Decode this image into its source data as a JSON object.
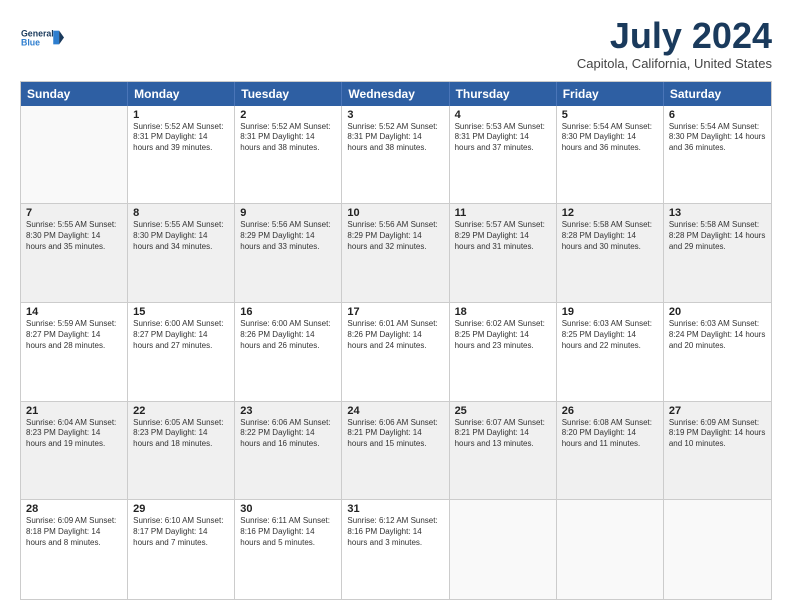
{
  "header": {
    "logo_line1": "General",
    "logo_line2": "Blue",
    "month": "July 2024",
    "location": "Capitola, California, United States"
  },
  "weekdays": [
    "Sunday",
    "Monday",
    "Tuesday",
    "Wednesday",
    "Thursday",
    "Friday",
    "Saturday"
  ],
  "weeks": [
    [
      {
        "day": "",
        "info": "",
        "empty": true
      },
      {
        "day": "1",
        "info": "Sunrise: 5:52 AM\nSunset: 8:31 PM\nDaylight: 14 hours\nand 39 minutes."
      },
      {
        "day": "2",
        "info": "Sunrise: 5:52 AM\nSunset: 8:31 PM\nDaylight: 14 hours\nand 38 minutes."
      },
      {
        "day": "3",
        "info": "Sunrise: 5:52 AM\nSunset: 8:31 PM\nDaylight: 14 hours\nand 38 minutes."
      },
      {
        "day": "4",
        "info": "Sunrise: 5:53 AM\nSunset: 8:31 PM\nDaylight: 14 hours\nand 37 minutes."
      },
      {
        "day": "5",
        "info": "Sunrise: 5:54 AM\nSunset: 8:30 PM\nDaylight: 14 hours\nand 36 minutes."
      },
      {
        "day": "6",
        "info": "Sunrise: 5:54 AM\nSunset: 8:30 PM\nDaylight: 14 hours\nand 36 minutes."
      }
    ],
    [
      {
        "day": "7",
        "info": "Sunrise: 5:55 AM\nSunset: 8:30 PM\nDaylight: 14 hours\nand 35 minutes."
      },
      {
        "day": "8",
        "info": "Sunrise: 5:55 AM\nSunset: 8:30 PM\nDaylight: 14 hours\nand 34 minutes."
      },
      {
        "day": "9",
        "info": "Sunrise: 5:56 AM\nSunset: 8:29 PM\nDaylight: 14 hours\nand 33 minutes."
      },
      {
        "day": "10",
        "info": "Sunrise: 5:56 AM\nSunset: 8:29 PM\nDaylight: 14 hours\nand 32 minutes."
      },
      {
        "day": "11",
        "info": "Sunrise: 5:57 AM\nSunset: 8:29 PM\nDaylight: 14 hours\nand 31 minutes."
      },
      {
        "day": "12",
        "info": "Sunrise: 5:58 AM\nSunset: 8:28 PM\nDaylight: 14 hours\nand 30 minutes."
      },
      {
        "day": "13",
        "info": "Sunrise: 5:58 AM\nSunset: 8:28 PM\nDaylight: 14 hours\nand 29 minutes."
      }
    ],
    [
      {
        "day": "14",
        "info": "Sunrise: 5:59 AM\nSunset: 8:27 PM\nDaylight: 14 hours\nand 28 minutes."
      },
      {
        "day": "15",
        "info": "Sunrise: 6:00 AM\nSunset: 8:27 PM\nDaylight: 14 hours\nand 27 minutes."
      },
      {
        "day": "16",
        "info": "Sunrise: 6:00 AM\nSunset: 8:26 PM\nDaylight: 14 hours\nand 26 minutes."
      },
      {
        "day": "17",
        "info": "Sunrise: 6:01 AM\nSunset: 8:26 PM\nDaylight: 14 hours\nand 24 minutes."
      },
      {
        "day": "18",
        "info": "Sunrise: 6:02 AM\nSunset: 8:25 PM\nDaylight: 14 hours\nand 23 minutes."
      },
      {
        "day": "19",
        "info": "Sunrise: 6:03 AM\nSunset: 8:25 PM\nDaylight: 14 hours\nand 22 minutes."
      },
      {
        "day": "20",
        "info": "Sunrise: 6:03 AM\nSunset: 8:24 PM\nDaylight: 14 hours\nand 20 minutes."
      }
    ],
    [
      {
        "day": "21",
        "info": "Sunrise: 6:04 AM\nSunset: 8:23 PM\nDaylight: 14 hours\nand 19 minutes."
      },
      {
        "day": "22",
        "info": "Sunrise: 6:05 AM\nSunset: 8:23 PM\nDaylight: 14 hours\nand 18 minutes."
      },
      {
        "day": "23",
        "info": "Sunrise: 6:06 AM\nSunset: 8:22 PM\nDaylight: 14 hours\nand 16 minutes."
      },
      {
        "day": "24",
        "info": "Sunrise: 6:06 AM\nSunset: 8:21 PM\nDaylight: 14 hours\nand 15 minutes."
      },
      {
        "day": "25",
        "info": "Sunrise: 6:07 AM\nSunset: 8:21 PM\nDaylight: 14 hours\nand 13 minutes."
      },
      {
        "day": "26",
        "info": "Sunrise: 6:08 AM\nSunset: 8:20 PM\nDaylight: 14 hours\nand 11 minutes."
      },
      {
        "day": "27",
        "info": "Sunrise: 6:09 AM\nSunset: 8:19 PM\nDaylight: 14 hours\nand 10 minutes."
      }
    ],
    [
      {
        "day": "28",
        "info": "Sunrise: 6:09 AM\nSunset: 8:18 PM\nDaylight: 14 hours\nand 8 minutes."
      },
      {
        "day": "29",
        "info": "Sunrise: 6:10 AM\nSunset: 8:17 PM\nDaylight: 14 hours\nand 7 minutes."
      },
      {
        "day": "30",
        "info": "Sunrise: 6:11 AM\nSunset: 8:16 PM\nDaylight: 14 hours\nand 5 minutes."
      },
      {
        "day": "31",
        "info": "Sunrise: 6:12 AM\nSunset: 8:16 PM\nDaylight: 14 hours\nand 3 minutes."
      },
      {
        "day": "",
        "info": "",
        "empty": true
      },
      {
        "day": "",
        "info": "",
        "empty": true
      },
      {
        "day": "",
        "info": "",
        "empty": true
      }
    ]
  ]
}
